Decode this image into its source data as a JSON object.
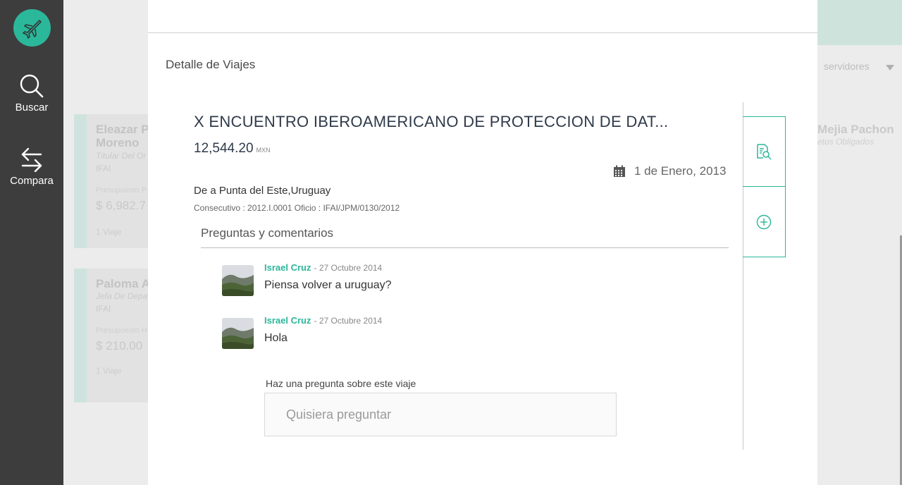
{
  "sidebar": {
    "logo_icon": "airplane-icon",
    "items": [
      {
        "label": "Buscar",
        "icon": "search-icon"
      },
      {
        "label": "Compara",
        "icon": "swap-arrows-icon"
      }
    ]
  },
  "background": {
    "select_label": "servidores",
    "cards": [
      {
        "name_line1": "Eleazar P",
        "name_line2": "Moreno",
        "role": "Titular Del Or",
        "org": "IFAI",
        "budget_label": "Presupuesto P",
        "amount": "$ 6,982.7",
        "trips": "1 Viaje"
      },
      {
        "name_line1": "Paloma A",
        "name_line2": "",
        "role": "Jefa De Depa",
        "org": "IFAI",
        "budget_label": "Presupuesto H",
        "amount": "$ 210.00",
        "trips": "1 Viaje"
      }
    ],
    "right_card": {
      "name": "Mejia Pachon",
      "sub": "etos Obligados"
    }
  },
  "modal": {
    "title": "Detalle de Viajes",
    "trip": {
      "title": "X ENCUENTRO IBEROAMERICANO DE PROTECCION DE DAT...",
      "amount": "12,544.20",
      "currency": "MXN",
      "date": "1 de Enero, 2013",
      "route": "De a Punta del Este,Uruguay",
      "meta": "Consecutivo : 2012.I.0001 Oficio : IFAI/JPM/0130/2012"
    },
    "comments_title": "Preguntas y comentarios",
    "comments": [
      {
        "author": "Israel Cruz",
        "date": "- 27 Octubre 2014",
        "text": "Piensa volver a uruguay?"
      },
      {
        "author": "Israel Cruz",
        "date": "- 27 Octubre 2014",
        "text": "Hola"
      }
    ],
    "ask": {
      "label": "Haz una pregunta sobre este viaje",
      "placeholder": "Quisiera preguntar"
    },
    "actions": [
      {
        "icon": "document-search-icon"
      },
      {
        "icon": "plus-circle-icon"
      }
    ]
  },
  "colors": {
    "accent": "#2bb79a",
    "sidebar_bg": "#3d3d3d"
  }
}
